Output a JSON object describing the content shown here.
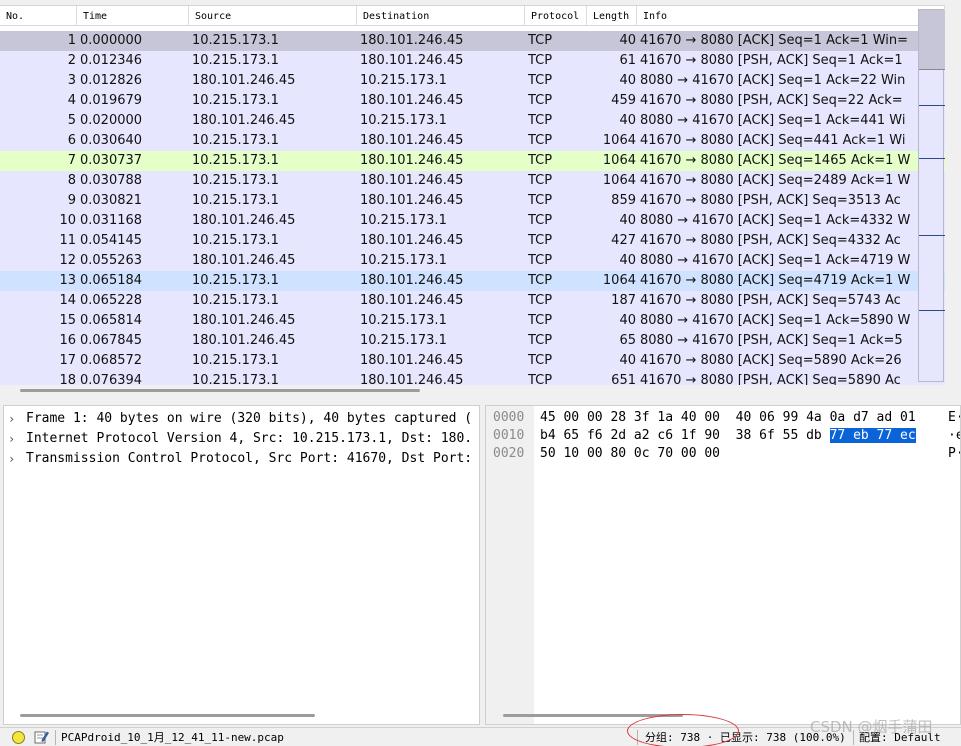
{
  "packet_list": {
    "columns": [
      "No.",
      "Time",
      "Source",
      "Destination",
      "Protocol",
      "Length",
      "Info"
    ],
    "rows": [
      {
        "no": "1",
        "time": "0.000000",
        "src": "10.215.173.1",
        "dst": "180.101.246.45",
        "proto": "TCP",
        "len": "40",
        "info": "41670 → 8080 [ACK] Seq=1 Ack=1 Win=",
        "style": "sel"
      },
      {
        "no": "2",
        "time": "0.012346",
        "src": "10.215.173.1",
        "dst": "180.101.246.45",
        "proto": "TCP",
        "len": "61",
        "info": "41670 → 8080 [PSH, ACK] Seq=1 Ack=1",
        "style": ""
      },
      {
        "no": "3",
        "time": "0.012826",
        "src": "180.101.246.45",
        "dst": "10.215.173.1",
        "proto": "TCP",
        "len": "40",
        "info": "8080 → 41670 [ACK] Seq=1 Ack=22 Win",
        "style": ""
      },
      {
        "no": "4",
        "time": "0.019679",
        "src": "10.215.173.1",
        "dst": "180.101.246.45",
        "proto": "TCP",
        "len": "459",
        "info": "41670 → 8080 [PSH, ACK] Seq=22 Ack=",
        "style": ""
      },
      {
        "no": "5",
        "time": "0.020000",
        "src": "180.101.246.45",
        "dst": "10.215.173.1",
        "proto": "TCP",
        "len": "40",
        "info": "8080 → 41670 [ACK] Seq=1 Ack=441 Wi",
        "style": ""
      },
      {
        "no": "6",
        "time": "0.030640",
        "src": "10.215.173.1",
        "dst": "180.101.246.45",
        "proto": "TCP",
        "len": "1064",
        "info": "41670 → 8080 [ACK] Seq=441 Ack=1 Wi",
        "style": ""
      },
      {
        "no": "7",
        "time": "0.030737",
        "src": "10.215.173.1",
        "dst": "180.101.246.45",
        "proto": "TCP",
        "len": "1064",
        "info": "41670 → 8080 [ACK] Seq=1465 Ack=1 W",
        "style": "green"
      },
      {
        "no": "8",
        "time": "0.030788",
        "src": "10.215.173.1",
        "dst": "180.101.246.45",
        "proto": "TCP",
        "len": "1064",
        "info": "41670 → 8080 [ACK] Seq=2489 Ack=1 W",
        "style": ""
      },
      {
        "no": "9",
        "time": "0.030821",
        "src": "10.215.173.1",
        "dst": "180.101.246.45",
        "proto": "TCP",
        "len": "859",
        "info": "41670 → 8080 [PSH, ACK] Seq=3513 Ac",
        "style": ""
      },
      {
        "no": "10",
        "time": "0.031168",
        "src": "180.101.246.45",
        "dst": "10.215.173.1",
        "proto": "TCP",
        "len": "40",
        "info": "8080 → 41670 [ACK] Seq=1 Ack=4332 W",
        "style": ""
      },
      {
        "no": "11",
        "time": "0.054145",
        "src": "10.215.173.1",
        "dst": "180.101.246.45",
        "proto": "TCP",
        "len": "427",
        "info": "41670 → 8080 [PSH, ACK] Seq=4332 Ac",
        "style": ""
      },
      {
        "no": "12",
        "time": "0.055263",
        "src": "180.101.246.45",
        "dst": "10.215.173.1",
        "proto": "TCP",
        "len": "40",
        "info": "8080 → 41670 [ACK] Seq=1 Ack=4719 W",
        "style": ""
      },
      {
        "no": "13",
        "time": "0.065184",
        "src": "10.215.173.1",
        "dst": "180.101.246.45",
        "proto": "TCP",
        "len": "1064",
        "info": "41670 → 8080 [ACK] Seq=4719 Ack=1 W",
        "style": "blue"
      },
      {
        "no": "14",
        "time": "0.065228",
        "src": "10.215.173.1",
        "dst": "180.101.246.45",
        "proto": "TCP",
        "len": "187",
        "info": "41670 → 8080 [PSH, ACK] Seq=5743 Ac",
        "style": ""
      },
      {
        "no": "15",
        "time": "0.065814",
        "src": "180.101.246.45",
        "dst": "10.215.173.1",
        "proto": "TCP",
        "len": "40",
        "info": "8080 → 41670 [ACK] Seq=1 Ack=5890 W",
        "style": ""
      },
      {
        "no": "16",
        "time": "0.067845",
        "src": "180.101.246.45",
        "dst": "10.215.173.1",
        "proto": "TCP",
        "len": "65",
        "info": "8080 → 41670 [PSH, ACK] Seq=1 Ack=5",
        "style": ""
      },
      {
        "no": "17",
        "time": "0.068572",
        "src": "10.215.173.1",
        "dst": "180.101.246.45",
        "proto": "TCP",
        "len": "40",
        "info": "41670 → 8080 [ACK] Seq=5890 Ack=26",
        "style": ""
      },
      {
        "no": "18",
        "time": "0.076394",
        "src": "10.215.173.1",
        "dst": "180.101.246.45",
        "proto": "TCP",
        "len": "651",
        "info": "41670 → 8080 [PSH, ACK] Seq=5890 Ac",
        "style": ""
      }
    ]
  },
  "detail": {
    "rows": [
      "Frame 1: 40 bytes on wire (320 bits), 40 bytes captured (",
      "Internet Protocol Version 4, Src: 10.215.173.1, Dst: 180.",
      "Transmission Control Protocol, Src Port: 41670, Dst Port:"
    ]
  },
  "bytes": {
    "rows": [
      {
        "offset": "0000",
        "hex_a": "45 00 00 28 3f 1a 40 00  40 06 99 4a 0a d7 ad 01",
        "hex_hl": "",
        "ascii": "E·"
      },
      {
        "offset": "0010",
        "hex_a": "b4 65 f6 2d a2 c6 1f 90  38 6f 55 db ",
        "hex_hl": "77 eb 77 ec",
        "ascii": "·e"
      },
      {
        "offset": "0020",
        "hex_a": "50 10 00 80 0c 70 00 00",
        "hex_hl": "",
        "ascii": "P·"
      }
    ]
  },
  "status": {
    "file_name": "PCAPdroid_10_1月_12_41_11-new.pcap",
    "packets": "分组: 738 · 已显示: 738 (100.0%)",
    "profile": "配置: Default",
    "watermark": "CSDN @烟手蒲田"
  },
  "colors": {
    "row_default": "#e7e6ff",
    "row_selected": "#c7c5d8",
    "row_green": "#e4ffc7",
    "row_blue": "#cfe2ff",
    "byte_highlight": "#0a64d8"
  }
}
